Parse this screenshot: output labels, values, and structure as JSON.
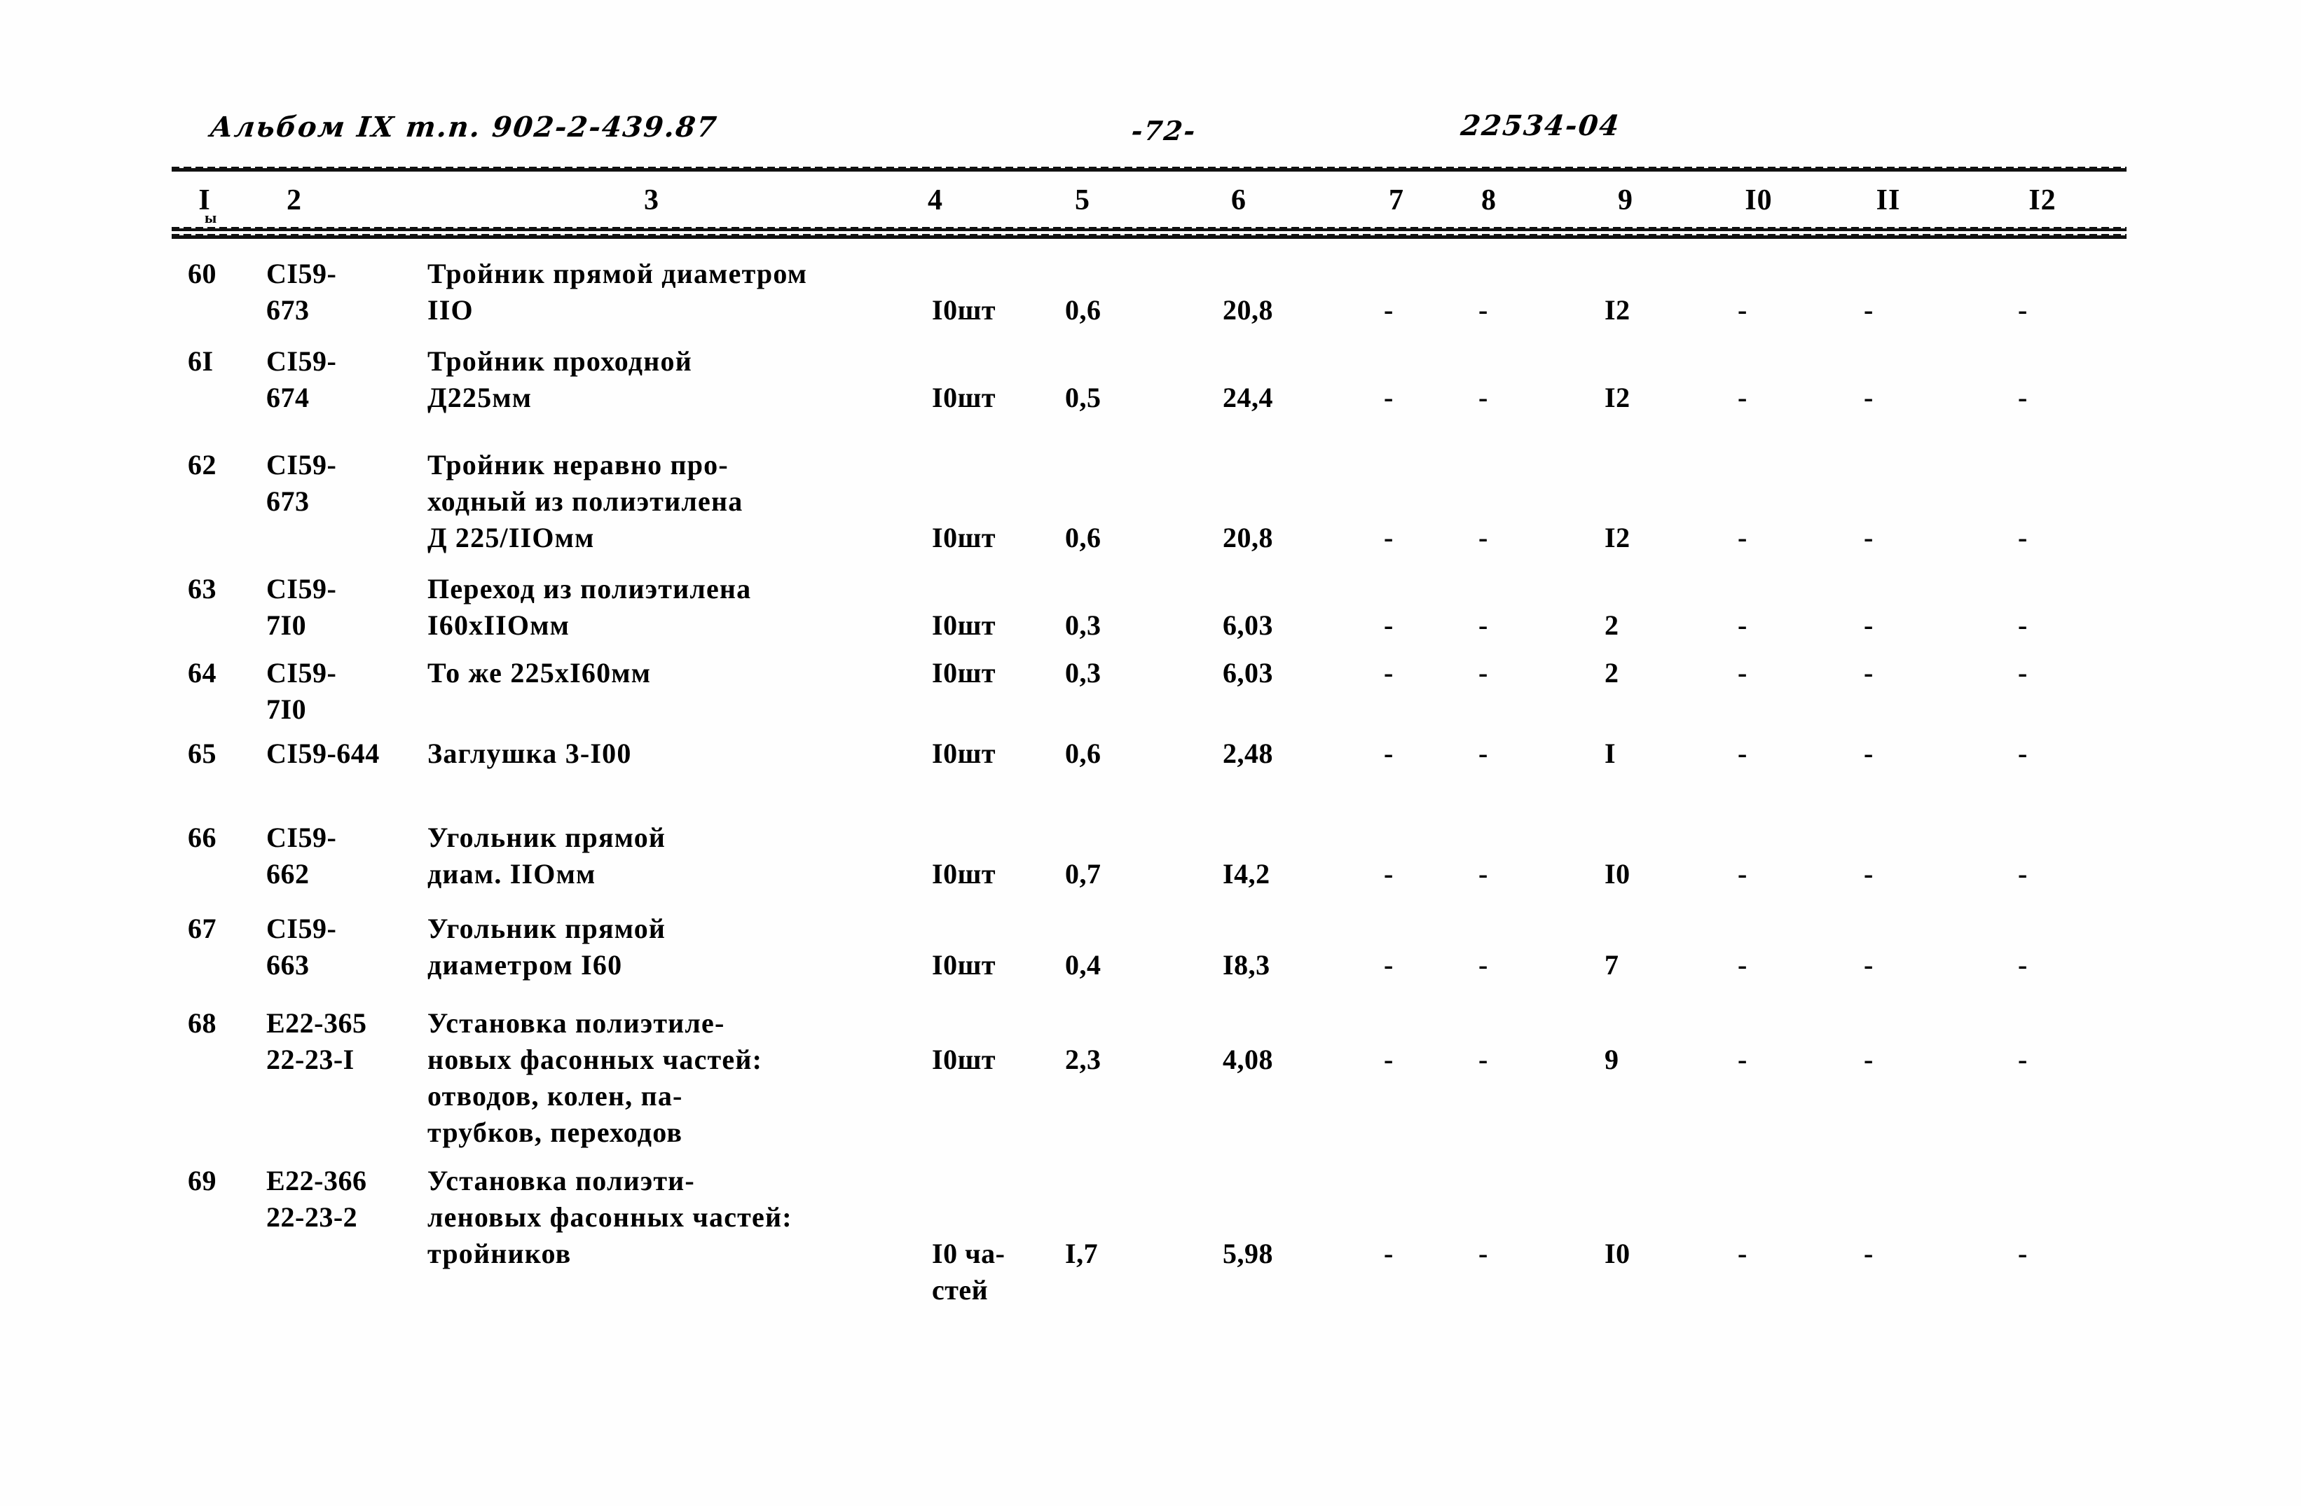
{
  "document": {
    "album_label": "Альбом IX т.п. 902-2-439.87",
    "page_number": "-72-",
    "doc_code": "22534-04",
    "tick_mark": "ы"
  },
  "table": {
    "column_headers": [
      "I",
      "2",
      "3",
      "4",
      "5",
      "6",
      "7",
      "8",
      "9",
      "I0",
      "II",
      "I2"
    ],
    "rows": [
      {
        "no": "60",
        "code_lines": [
          "СI59-",
          "673"
        ],
        "desc_lines": [
          "Тройник прямой диаметром",
          "IIО"
        ],
        "unit": "I0шт",
        "c5": "0,6",
        "c6": "20,8",
        "c7": "-",
        "c8": "-",
        "c9": "I2",
        "c10": "-",
        "c11": "-",
        "c12": "-"
      },
      {
        "no": "6I",
        "code_lines": [
          "СI59-",
          "674"
        ],
        "desc_lines": [
          "Тройник проходной",
          "Д225мм"
        ],
        "unit": "I0шт",
        "c5": "0,5",
        "c6": "24,4",
        "c7": "-",
        "c8": "-",
        "c9": "I2",
        "c10": "-",
        "c11": "-",
        "c12": "-"
      },
      {
        "no": "62",
        "code_lines": [
          "СI59-",
          "673"
        ],
        "desc_lines": [
          "Тройник неравно про-",
          "ходный из полиэтилена",
          "Д 225/IIОмм"
        ],
        "unit": "I0шт",
        "c5": "0,6",
        "c6": "20,8",
        "c7": "-",
        "c8": "-",
        "c9": "I2",
        "c10": "-",
        "c11": "-",
        "c12": "-"
      },
      {
        "no": "63",
        "code_lines": [
          "СI59-",
          "7I0"
        ],
        "desc_lines": [
          "Переход из полиэтилена",
          "I60хIIОмм"
        ],
        "unit": "I0шт",
        "c5": "0,3",
        "c6": "6,03",
        "c7": "-",
        "c8": "-",
        "c9": "2",
        "c10": "-",
        "c11": "-",
        "c12": "-"
      },
      {
        "no": "64",
        "code_lines": [
          "СI59-",
          "7I0"
        ],
        "desc_lines": [
          "То же 225хI60мм"
        ],
        "unit": "I0шт",
        "c5": "0,3",
        "c6": "6,03",
        "c7": "-",
        "c8": "-",
        "c9": "2",
        "c10": "-",
        "c11": "-",
        "c12": "-"
      },
      {
        "no": "65",
        "code_lines": [
          "СI59-644"
        ],
        "desc_lines": [
          "Заглушка 3-I00"
        ],
        "unit": "I0шт",
        "c5": "0,6",
        "c6": "2,48",
        "c7": "-",
        "c8": "-",
        "c9": "I",
        "c10": "-",
        "c11": "-",
        "c12": "-"
      },
      {
        "no": "66",
        "code_lines": [
          "СI59-",
          "662"
        ],
        "desc_lines": [
          "Угольник прямой",
          "диам. IIОмм"
        ],
        "unit": "I0шт",
        "c5": "0,7",
        "c6": "I4,2",
        "c7": "-",
        "c8": "-",
        "c9": "I0",
        "c10": "-",
        "c11": "-",
        "c12": "-"
      },
      {
        "no": "67",
        "code_lines": [
          "СI59-",
          "663"
        ],
        "desc_lines": [
          "Угольник прямой",
          "диаметром I60"
        ],
        "unit": "I0шт",
        "c5": "0,4",
        "c6": "I8,3",
        "c7": "-",
        "c8": "-",
        "c9": "7",
        "c10": "-",
        "c11": "-",
        "c12": "-"
      },
      {
        "no": "68",
        "code_lines": [
          "Е22-365",
          "22-23-I"
        ],
        "desc_lines": [
          "Установка полиэтиле-",
          "новых фасонных частей:",
          "отводов, колен, па-",
          "трубков, переходов"
        ],
        "unit": "I0шт",
        "c5": "2,3",
        "c6": "4,08",
        "c7": "-",
        "c8": "-",
        "c9": "9",
        "c10": "-",
        "c11": "-",
        "c12": "-"
      },
      {
        "no": "69",
        "code_lines": [
          "Е22-366",
          "22-23-2"
        ],
        "desc_lines": [
          "Установка полиэти-",
          "леновых фасонных частей:",
          "тройников"
        ],
        "unit": "I0 ча-\nстей",
        "c5": "I,7",
        "c6": "5,98",
        "c7": "-",
        "c8": "-",
        "c9": "I0",
        "c10": "-",
        "c11": "-",
        "c12": "-"
      }
    ]
  }
}
